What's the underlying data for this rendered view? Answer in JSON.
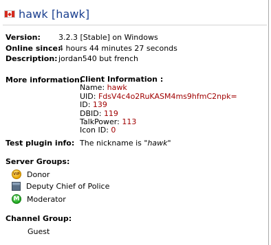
{
  "header": {
    "title": "hawk [hawk]",
    "flag_icon": "canada-flag-icon"
  },
  "info": {
    "version_label": "Version:",
    "version_value": "3.2.3 [Stable] on Windows",
    "online_label": "Online since:",
    "online_value": "4 hours 44 minutes 27 seconds",
    "description_label": "Description:",
    "description_value": "jordan540 but french",
    "more_label": "More information:"
  },
  "client_info": {
    "title": "Client Information :",
    "name_label": "Name: ",
    "name_value": "hawk",
    "uid_label": "UID: ",
    "uid_value": "FdsV4c4o2RuKASM4ms9hfmC2npk=",
    "id_label": "ID: ",
    "id_value": "139",
    "dbid_label": "DBID: ",
    "dbid_value": "119",
    "talkpower_label": "TalkPower: ",
    "talkpower_value": "113",
    "iconid_label": "Icon ID: ",
    "iconid_value": "0"
  },
  "test_plugin": {
    "label": "Test plugin info:",
    "text": "The nickname is ",
    "nickname": "\"hawk\""
  },
  "server_groups": {
    "heading": "Server Groups:",
    "items": [
      {
        "label": "Donor",
        "icon": "vip-icon",
        "icon_text": "VIP"
      },
      {
        "label": "Deputy Chief of Police",
        "icon": "police-badge-icon"
      },
      {
        "label": "Moderator",
        "icon": "moderator-m-icon",
        "icon_text": "M"
      }
    ]
  },
  "channel_group": {
    "heading": "Channel Group:",
    "value": "Guest"
  },
  "colors": {
    "title": "#1a3f8f",
    "value_red": "#a00000"
  }
}
